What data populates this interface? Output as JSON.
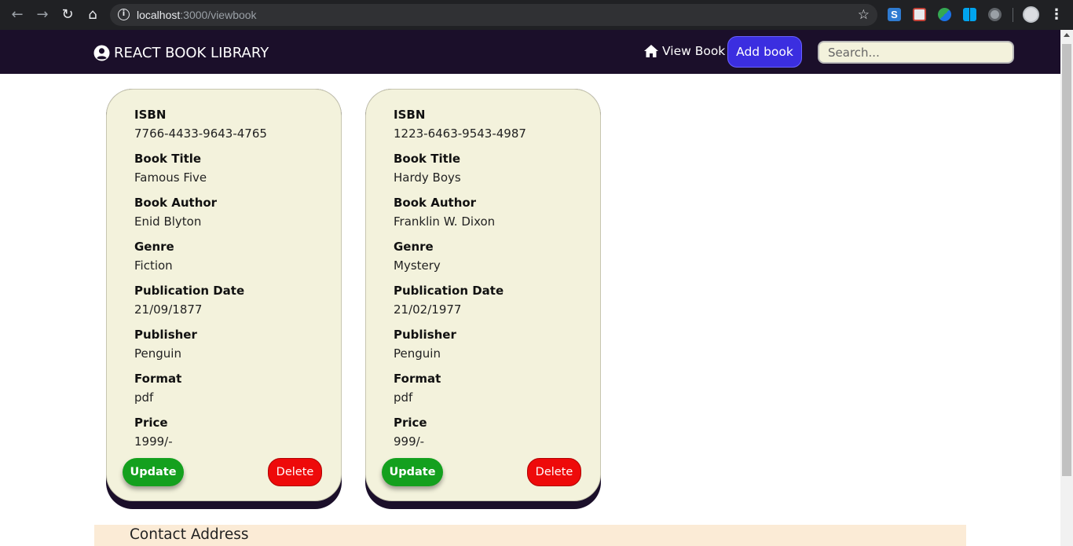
{
  "browser": {
    "url_host": "localhost",
    "url_path": ":3000/viewbook"
  },
  "navbar": {
    "brand": "REACT BOOK LIBRARY",
    "view_book_label": "View Book",
    "add_book_label": "Add book",
    "search_placeholder": "Search...",
    "background_color": "#1b0f2a",
    "add_button_color": "#3b2ee0"
  },
  "labels": {
    "isbn": "ISBN",
    "title": "Book Title",
    "author": "Book Author",
    "genre": "Genre",
    "pub_date": "Publication Date",
    "publisher": "Publisher",
    "format": "Format",
    "price": "Price",
    "update": "Update",
    "delete": "Delete"
  },
  "books": [
    {
      "isbn": "7766-4433-9643-4765",
      "title": "Famous Five",
      "author": "Enid Blyton",
      "genre": "Fiction",
      "pub_date": "21/09/1877",
      "publisher": "Penguin",
      "format": "pdf",
      "price": "1999/-"
    },
    {
      "isbn": "1223-6463-9543-4987",
      "title": "Hardy Boys",
      "author": "Franklin W. Dixon",
      "genre": "Mystery",
      "pub_date": "21/02/1977",
      "publisher": "Penguin",
      "format": "pdf",
      "price": "999/-"
    }
  ],
  "footer": {
    "heading": "Contact Address"
  },
  "colors": {
    "card_bg": "#f3f2dc",
    "update_green": "#14a01e",
    "delete_red": "#ee0a0a",
    "footer_bg": "#fbebd6"
  },
  "icons": {
    "brand": "user-circle-icon",
    "view_book": "home-icon"
  }
}
